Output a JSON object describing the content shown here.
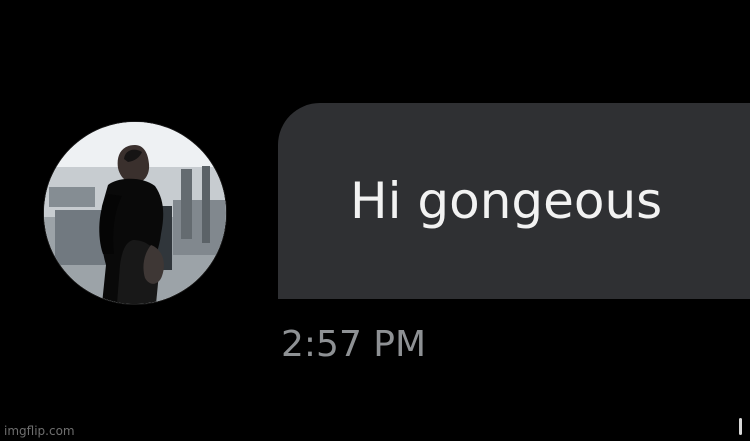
{
  "conversation": {
    "avatar": {
      "icon": "profile-photo"
    },
    "message": {
      "text": "Hi gongeous",
      "timestamp": "2:57 PM"
    }
  },
  "watermark": {
    "text": "imgflip.com"
  },
  "colors": {
    "background": "#000000",
    "bubble": "#2f3033",
    "message_text": "#f2f2f2",
    "timestamp": "#8e9194",
    "watermark": "#6f6f6f"
  }
}
